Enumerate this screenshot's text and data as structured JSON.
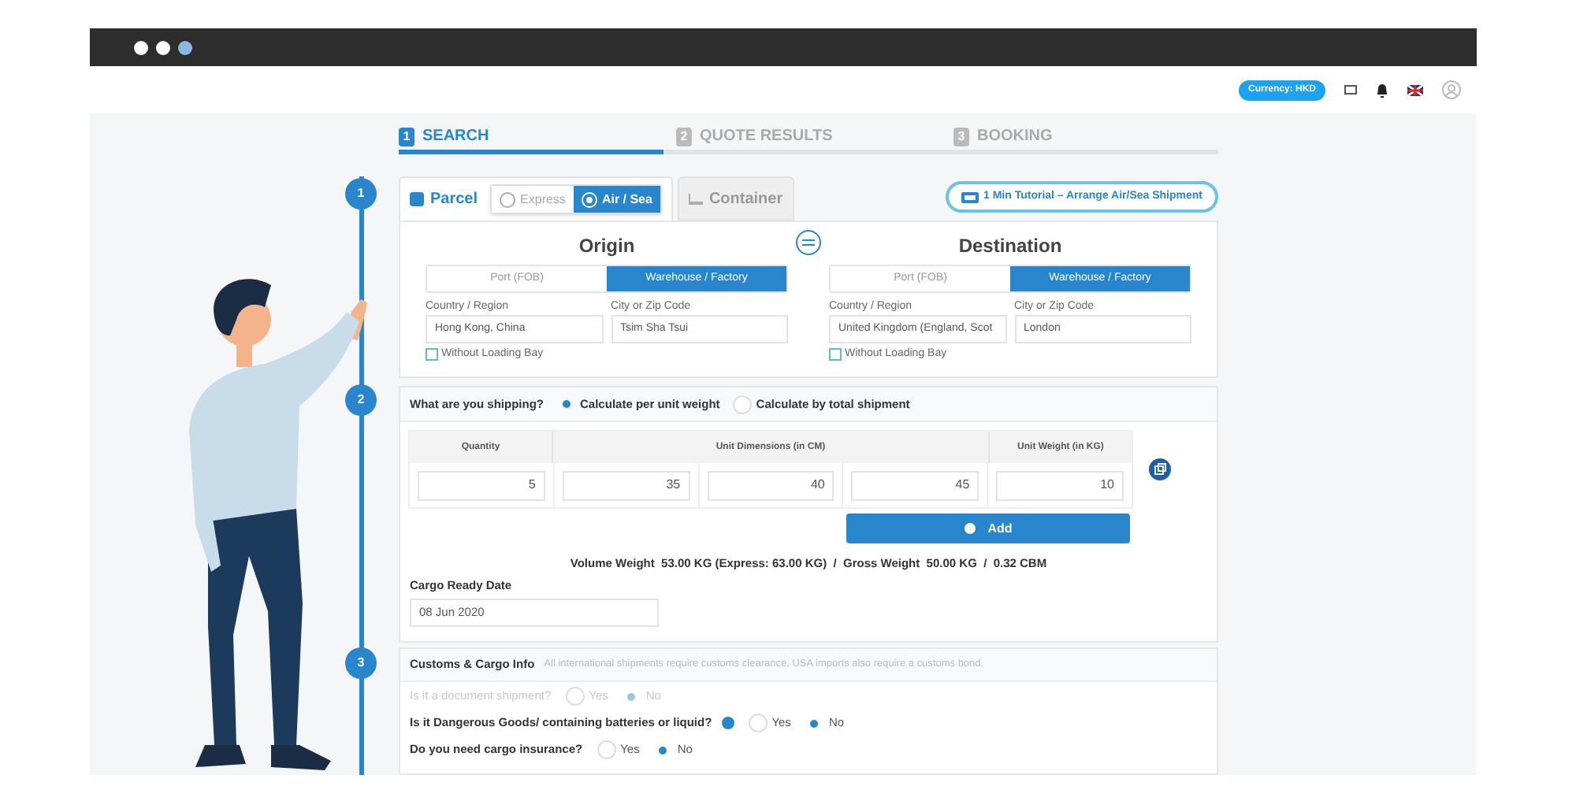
{
  "header": {
    "currency": "Currency: HKD"
  },
  "steps": [
    {
      "number": "1",
      "label": "SEARCH",
      "selected": true
    },
    {
      "number": "2",
      "label": "QUOTE RESULTS",
      "selected": false
    },
    {
      "number": "3",
      "label": "BOOKING",
      "selected": false
    }
  ],
  "timeline": [
    "1",
    "2",
    "3"
  ],
  "shipment_tabs": [
    {
      "kind": "parcel",
      "label": "Parcel",
      "selected": true
    },
    {
      "kind": "container",
      "label": "Container",
      "selected": false
    }
  ],
  "parcel_modes": [
    {
      "label": "Express",
      "selected": false
    },
    {
      "label": "Air / Sea",
      "selected": true
    }
  ],
  "tutorial": "1 Min Tutorial – Arrange Air/Sea Shipment",
  "locations": [
    {
      "title": "Origin",
      "options": [
        {
          "label": "Port (FOB)",
          "selected": false
        },
        {
          "label": "Warehouse / Factory",
          "selected": true
        }
      ],
      "fields": [
        {
          "label": "Country / Region",
          "value": "Hong Kong, China"
        },
        {
          "label": "City or Zip Code",
          "value": "Tsim Sha Tsui"
        }
      ],
      "loading_bay": {
        "label": "Without Loading Bay",
        "checked": false
      }
    },
    {
      "title": "Destination",
      "options": [
        {
          "label": "Port (FOB)",
          "selected": false
        },
        {
          "label": "Warehouse / Factory",
          "selected": true
        }
      ],
      "fields": [
        {
          "label": "Country / Region",
          "value": "United Kingdom (England, Scot"
        },
        {
          "label": "City or Zip Code",
          "value": "London"
        }
      ],
      "loading_bay": {
        "label": "Without Loading Bay",
        "checked": false
      }
    }
  ],
  "shipping": {
    "question": "What are you shipping?",
    "options": [
      {
        "label": "Calculate per unit weight",
        "selected": true
      },
      {
        "label": "Calculate by total shipment",
        "selected": false
      }
    ],
    "columns": [
      "Quantity",
      "Unit Dimensions (in CM)",
      "Unit Weight (in KG)"
    ],
    "row": [
      "5",
      "35",
      "40",
      "45",
      "10"
    ],
    "add": "Add",
    "summary": "Volume Weight  53.00 KG (Express: 63.00 KG)  /  Gross Weight  50.00 KG  /  0.32 CBM",
    "date": {
      "label": "Cargo Ready Date",
      "value": "08 Jun 2020"
    }
  },
  "customs": {
    "title": "Customs & Cargo Info",
    "note": "All international shipments require customs clearance. USA imports also require a customs bond.",
    "questions": [
      {
        "text": "Is it a document shipment?",
        "disabled": true,
        "info": false,
        "options": [
          {
            "label": "Yes",
            "selected": false
          },
          {
            "label": "No",
            "selected": true
          }
        ]
      },
      {
        "text": "Is it Dangerous Goods/ containing batteries or liquid?",
        "disabled": false,
        "info": true,
        "options": [
          {
            "label": "Yes",
            "selected": false
          },
          {
            "label": "No",
            "selected": true
          }
        ]
      },
      {
        "text": "Do you need cargo insurance?",
        "disabled": false,
        "info": false,
        "options": [
          {
            "label": "Yes",
            "selected": false
          },
          {
            "label": "No",
            "selected": true
          }
        ]
      }
    ]
  }
}
